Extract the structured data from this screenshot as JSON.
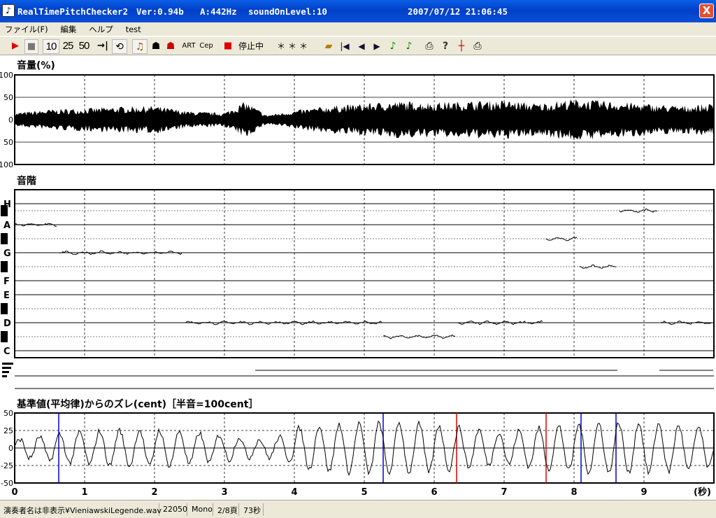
{
  "window": {
    "app_name": "RealTimePitchChecker2",
    "version": "Ver:0.94b",
    "a_freq": "A:442Hz",
    "sound_on_level": "soundOnLevel:10",
    "datetime": "2007/07/12 21:06:45",
    "close_label": "X"
  },
  "menu": [
    "ファイル(F)",
    "編集",
    "ヘルプ",
    "test"
  ],
  "toolbar": {
    "speed_10": "10",
    "speed_25": "25",
    "speed_50": "50",
    "art_label": "ART",
    "cep_label": "Cep",
    "stop_label": "停止中",
    "note_display": "＊＊＊"
  },
  "panels": {
    "volume_title": "音量(%)",
    "scale_title": "音階",
    "cent_title": "基準値(平均律)からのズレ(cent)［半音=100cent］"
  },
  "chart_data": [
    {
      "type": "area",
      "title": "音量(%)",
      "yticks": [
        "100",
        "50",
        "0",
        "50",
        "100"
      ],
      "ylim": [
        -100,
        100
      ],
      "x": [
        0,
        0.5,
        1,
        1.5,
        2,
        2.5,
        3,
        3.3,
        3.6,
        4,
        4.5,
        5,
        5.5,
        6,
        6.5,
        7,
        7.5,
        8,
        8.5,
        9,
        9.5,
        9.98
      ],
      "envelope": [
        15,
        22,
        25,
        28,
        30,
        18,
        15,
        40,
        10,
        20,
        30,
        35,
        40,
        38,
        40,
        42,
        35,
        45,
        40,
        35,
        30,
        35
      ]
    },
    {
      "type": "line",
      "title": "音階",
      "yticks": [
        "H",
        "A",
        "G",
        "F",
        "E",
        "D",
        "C"
      ],
      "segments": [
        {
          "from": 0.0,
          "to": 0.6,
          "note": "A"
        },
        {
          "from": 0.65,
          "to": 2.4,
          "note": "G"
        },
        {
          "from": 2.45,
          "to": 5.25,
          "note": "D"
        },
        {
          "from": 5.28,
          "to": 6.3,
          "note": "C#"
        },
        {
          "from": 6.33,
          "to": 7.55,
          "note": "D"
        },
        {
          "from": 7.6,
          "to": 8.05,
          "note": "G#"
        },
        {
          "from": 8.08,
          "to": 8.6,
          "note": "F#"
        },
        {
          "from": 8.65,
          "to": 9.2,
          "note": "A#"
        },
        {
          "from": 9.25,
          "to": 9.98,
          "note": "D"
        }
      ]
    },
    {
      "type": "line",
      "title": "基準値(平均律)からのズレ(cent)［半音=100cent］",
      "xlabel": "(秒)",
      "xticks": [
        "0",
        "1",
        "2",
        "3",
        "4",
        "5",
        "6",
        "7",
        "8",
        "9"
      ],
      "yticks": [
        "50",
        "25",
        "0",
        "-25",
        "-50"
      ],
      "ylim": [
        -50,
        50
      ],
      "xlim": [
        0,
        10
      ],
      "note_change_markers_blue": [
        0.63,
        5.27,
        8.1,
        8.6
      ],
      "note_change_markers_red": [
        6.32,
        7.6
      ]
    }
  ],
  "colors": {
    "trace": "#000000",
    "marker_blue": "#0000cc",
    "marker_red": "#dd0000",
    "titlebar": "#0040c8",
    "chrome": "#ece9d8"
  },
  "status": {
    "file": "演奏者名は非表示¥VieniawskiLegende.wav",
    "rate": "22050",
    "channels": "Mono",
    "page": "2/8頁",
    "duration": "73秒"
  }
}
